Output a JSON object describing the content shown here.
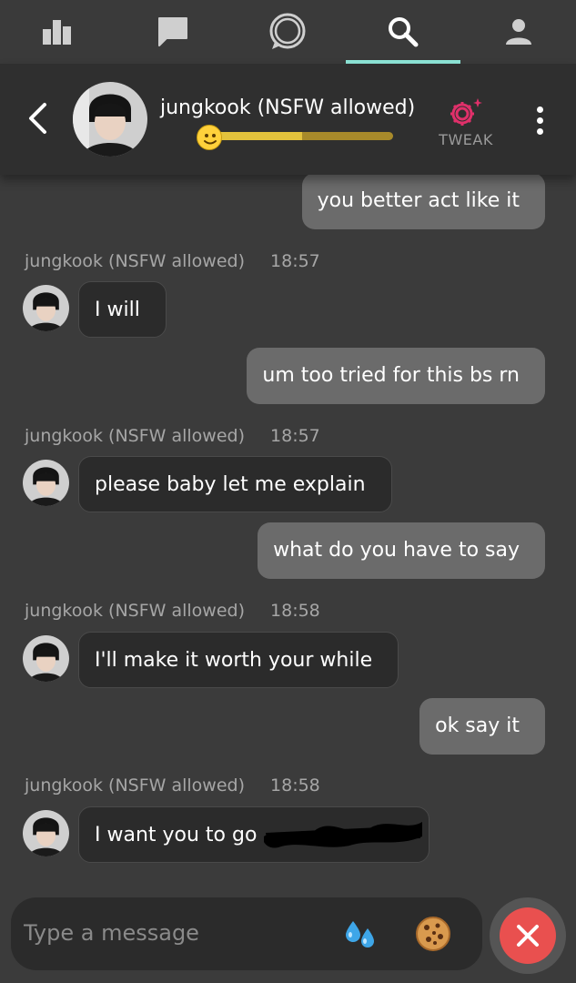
{
  "nav": {
    "tabs": [
      {
        "icon": "bar-chart-icon"
      },
      {
        "icon": "message-square-icon"
      },
      {
        "icon": "chat-bubble-icon"
      },
      {
        "icon": "search-icon",
        "active": true
      },
      {
        "icon": "person-icon"
      }
    ]
  },
  "header": {
    "name": "jungkook (NSFW allowed)",
    "level_progress": 0.5,
    "tweak_label": "TWEAK"
  },
  "messages": [
    {
      "from": "user",
      "text": "you better act like it"
    },
    {
      "from": "bot",
      "sender": "jungkook (NSFW allowed)",
      "time": "18:57",
      "text": "I will"
    },
    {
      "from": "user",
      "text": "um too tried for this bs rn"
    },
    {
      "from": "bot",
      "sender": "jungkook (NSFW allowed)",
      "time": "18:57",
      "text": "please baby let me explain"
    },
    {
      "from": "user",
      "text": "what do you have to say"
    },
    {
      "from": "bot",
      "sender": "jungkook (NSFW allowed)",
      "time": "18:58",
      "text": "I'll make it worth your while"
    },
    {
      "from": "user",
      "text": "ok say it"
    },
    {
      "from": "bot",
      "sender": "jungkook (NSFW allowed)",
      "time": "18:58",
      "text": "I want you to go"
    }
  ],
  "composer": {
    "placeholder": "Type a message",
    "emoji_1": "sweat-droplets-icon",
    "emoji_2": "cookie-icon"
  },
  "colors": {
    "accent_teal": "#8ee6d8",
    "tweak_pink": "#e0306a",
    "close_red": "#e9504f",
    "level_bar": "#e3c23c"
  }
}
